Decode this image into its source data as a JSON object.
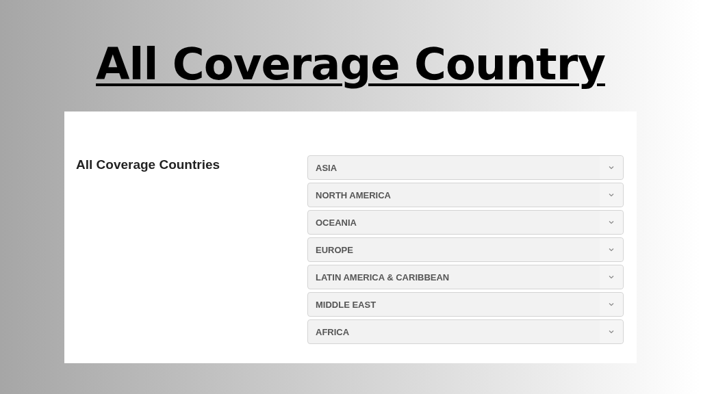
{
  "title": "All Coverage Country",
  "panel": {
    "heading": "All Coverage Countries",
    "regions": [
      {
        "label": "ASIA",
        "expanded": false
      },
      {
        "label": "NORTH AMERICA",
        "expanded": false
      },
      {
        "label": "OCEANIA",
        "expanded": false
      },
      {
        "label": "EUROPE",
        "expanded": false
      },
      {
        "label": "LATIN AMERICA & CARIBBEAN",
        "expanded": false
      },
      {
        "label": "MIDDLE EAST",
        "expanded": false
      },
      {
        "label": "AFRICA",
        "expanded": false
      }
    ]
  }
}
